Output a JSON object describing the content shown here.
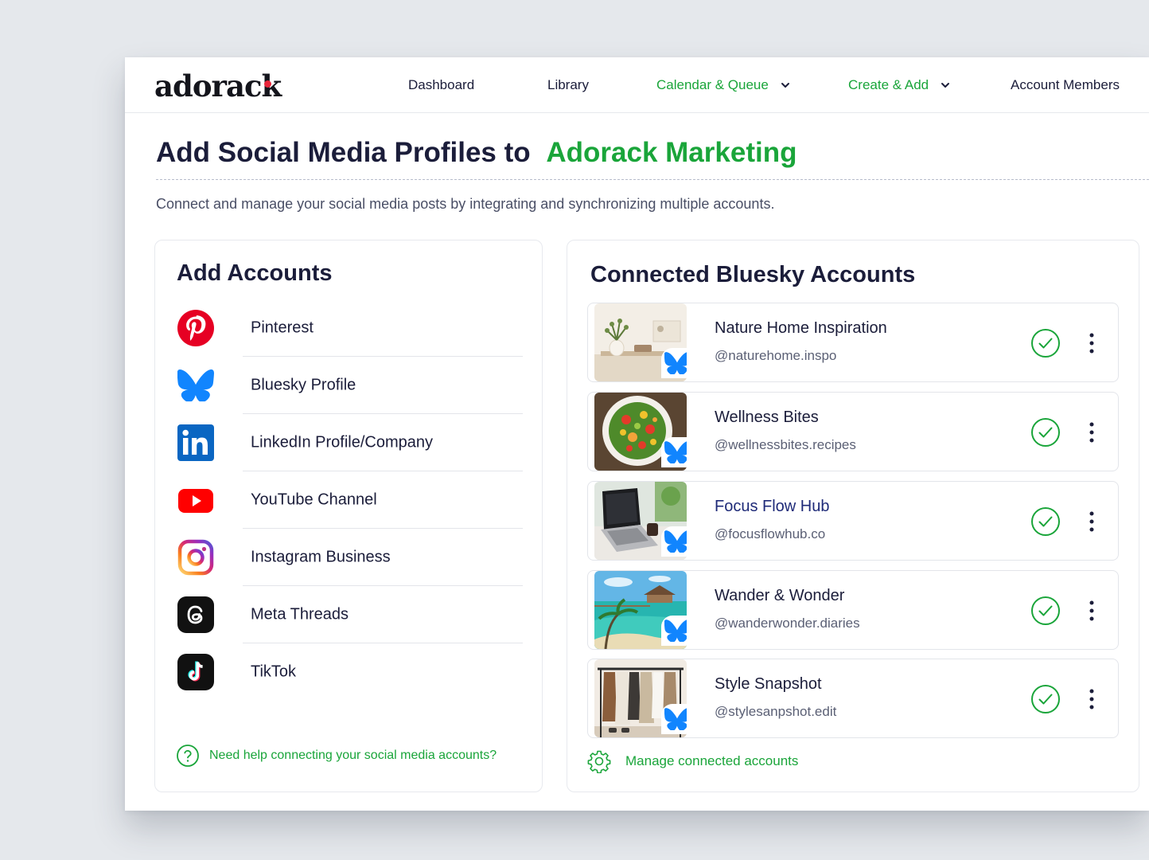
{
  "brand": {
    "name": "adorack",
    "accent": "#1aa53a",
    "dot_color": "#e8263b"
  },
  "nav": {
    "dashboard": "Dashboard",
    "library": "Library",
    "calendar": "Calendar & Queue",
    "create": "Create & Add",
    "members": "Account Members"
  },
  "header": {
    "title_prefix": "Add Social Media Profiles to",
    "title_accent": "Adorack Marketing",
    "subtitle": "Connect and manage your social media posts by integrating and synchronizing multiple accounts."
  },
  "add_accounts": {
    "title": "Add Accounts",
    "platforms": [
      {
        "label": "Pinterest",
        "icon": "pinterest-icon"
      },
      {
        "label": "Bluesky Profile",
        "icon": "bluesky-icon"
      },
      {
        "label": "LinkedIn Profile/Company",
        "icon": "linkedin-icon"
      },
      {
        "label": "YouTube Channel",
        "icon": "youtube-icon"
      },
      {
        "label": "Instagram Business",
        "icon": "instagram-icon"
      },
      {
        "label": "Meta Threads",
        "icon": "threads-icon"
      },
      {
        "label": "TikTok",
        "icon": "tiktok-icon"
      }
    ],
    "help": "Need help connecting your social media accounts?"
  },
  "connected": {
    "title": "Connected Bluesky Accounts",
    "accounts": [
      {
        "name": "Nature Home Inspiration",
        "handle": "@naturehome.inspo",
        "status": "connected"
      },
      {
        "name": "Wellness Bites",
        "handle": "@wellnessbites.recipes",
        "status": "connected"
      },
      {
        "name": "Focus Flow Hub",
        "handle": "@focusflowhub.co",
        "status": "connected"
      },
      {
        "name": "Wander & Wonder",
        "handle": "@wanderwonder.diaries",
        "status": "connected"
      },
      {
        "name": "Style Snapshot",
        "handle": "@stylesanpshot.edit",
        "status": "connected"
      }
    ],
    "manage": "Manage connected accounts"
  }
}
